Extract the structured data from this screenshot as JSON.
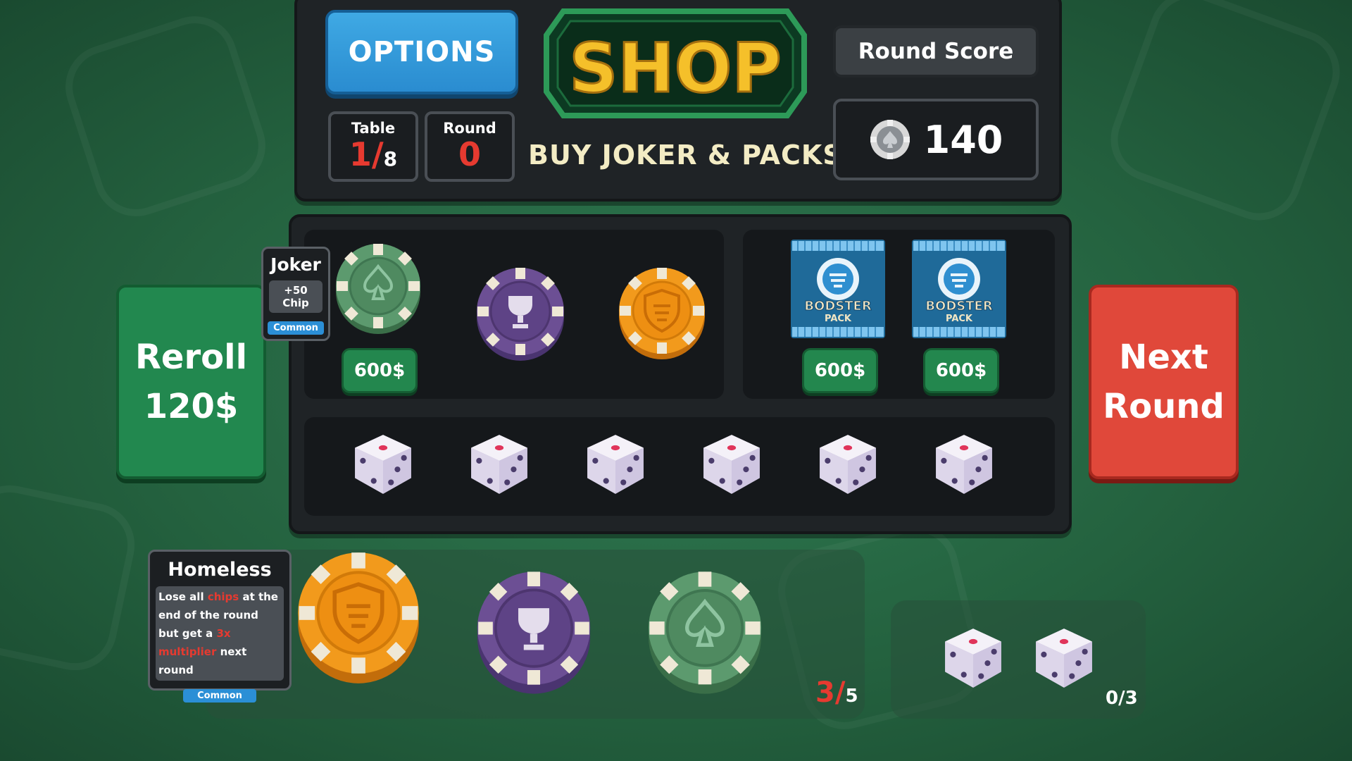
{
  "header": {
    "options_label": "OPTIONS",
    "shop_title": "SHOP",
    "subtitle": "BUY JOKER & PACKS!",
    "table_label": "Table",
    "table_value": "1",
    "table_total": "8",
    "round_label": "Round",
    "round_value": "0",
    "round_score_label": "Round Score",
    "round_score_value": "140"
  },
  "shop": {
    "reroll_label": "Reroll",
    "reroll_price": "120$",
    "next_line1": "Next",
    "next_line2": "Round",
    "joker_tooltip": {
      "title": "Joker",
      "effect": "+50 Chip",
      "rarity": "Common"
    },
    "chips": [
      {
        "type": "spade",
        "color": "green",
        "price": "600$"
      },
      {
        "type": "trophy",
        "color": "purple"
      },
      {
        "type": "shield",
        "color": "orange"
      }
    ],
    "packs": [
      {
        "name": "BODSTER",
        "sub": "PACK",
        "price": "600$"
      },
      {
        "name": "BODSTER",
        "sub": "PACK",
        "price": "600$"
      }
    ],
    "dice_count": 6
  },
  "inventory": {
    "homeless_tooltip": {
      "title": "Homeless",
      "text_1": "Lose all ",
      "text_hl1": "chips",
      "text_2": " at the end of the round but get a ",
      "text_hl2": "3x multiplier",
      "text_3": " next round",
      "rarity": "Common"
    },
    "chips_count": "3",
    "chips_max": "5",
    "dice_count_text": "0/3"
  },
  "colors": {
    "chip_green": "#5c9a6e",
    "chip_purple": "#6c4f94",
    "chip_orange": "#f29a1c",
    "price_green": "#23874e",
    "options_blue": "#2a8cd0",
    "next_red": "#e0483a",
    "count_red": "#e63a30"
  },
  "icons": [
    "spade-icon",
    "trophy-icon",
    "shield-icon",
    "poker-chip-icon",
    "dice-icon",
    "pack-icon"
  ]
}
